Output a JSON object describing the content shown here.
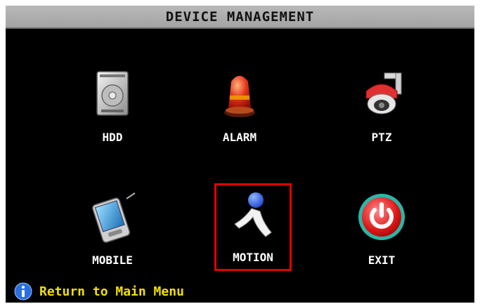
{
  "window": {
    "title": "DEVICE MANAGEMENT"
  },
  "menu": {
    "items": [
      {
        "label": "HDD",
        "icon": "hdd-icon"
      },
      {
        "label": "ALARM",
        "icon": "alarm-icon"
      },
      {
        "label": "PTZ",
        "icon": "ptz-camera-icon"
      },
      {
        "label": "MOBILE",
        "icon": "mobile-icon"
      },
      {
        "label": "MOTION",
        "icon": "motion-icon",
        "selected": true
      },
      {
        "label": "EXIT",
        "icon": "exit-icon"
      }
    ]
  },
  "footer": {
    "hint": "Return to Main Menu",
    "icon": "info-icon"
  },
  "colors": {
    "background": "#000000",
    "title_bar": "#adadad",
    "selection": "#e10000",
    "hint_text": "#f0e000"
  }
}
